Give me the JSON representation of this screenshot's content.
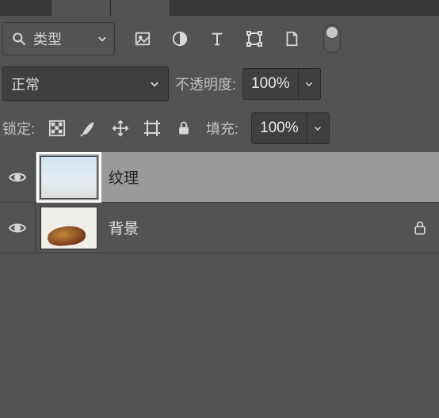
{
  "filter": {
    "label": "类型"
  },
  "blend": {
    "mode": "正常",
    "opacity_label": "不透明度:",
    "opacity_value": "100%"
  },
  "lock": {
    "label": "锁定:",
    "fill_label": "填充:",
    "fill_value": "100%"
  },
  "icons": {
    "search": "search-icon",
    "image": "image-icon",
    "circle_half": "adjustment-icon",
    "text": "text-icon",
    "shape": "shape-icon",
    "smart": "smart-object-icon"
  },
  "layers": [
    {
      "name": "纹理",
      "selected": true,
      "locked": false,
      "thumb": "sky"
    },
    {
      "name": "背景",
      "selected": false,
      "locked": true,
      "thumb": "pizza"
    }
  ]
}
